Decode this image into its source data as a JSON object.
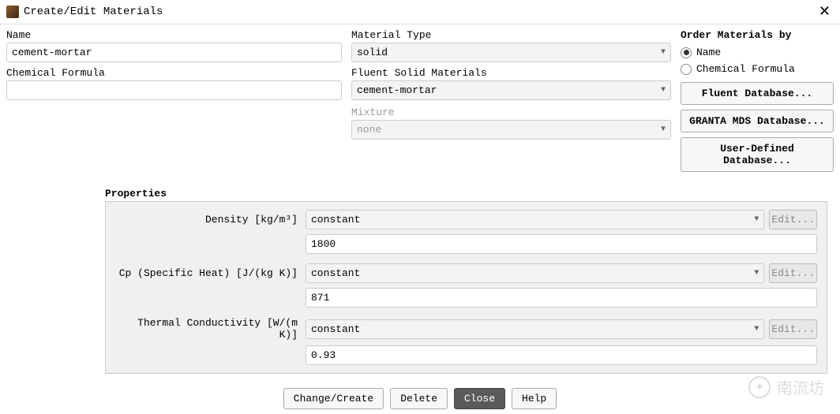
{
  "window": {
    "title": "Create/Edit Materials"
  },
  "left": {
    "name_label": "Name",
    "name_value": "cement-mortar",
    "formula_label": "Chemical Formula",
    "formula_value": ""
  },
  "mid": {
    "type_label": "Material Type",
    "type_value": "solid",
    "fluent_label": "Fluent Solid Materials",
    "fluent_value": "cement-mortar",
    "mixture_label": "Mixture",
    "mixture_value": "none"
  },
  "right": {
    "order_label": "Order Materials by",
    "radio_name": "Name",
    "radio_formula": "Chemical Formula",
    "btn_fluent": "Fluent Database...",
    "btn_granta": "GRANTA MDS Database...",
    "btn_user": "User-Defined Database..."
  },
  "properties": {
    "title": "Properties",
    "density": {
      "label": "Density [kg/m³]",
      "mode": "constant",
      "value": "1800",
      "edit": "Edit..."
    },
    "cp": {
      "label": "Cp (Specific Heat) [J/(kg K)]",
      "mode": "constant",
      "value": "871",
      "edit": "Edit..."
    },
    "k": {
      "label": "Thermal Conductivity [W/(m K)]",
      "mode": "constant",
      "value": "0.93",
      "edit": "Edit..."
    }
  },
  "buttons": {
    "change": "Change/Create",
    "delete": "Delete",
    "close": "Close",
    "help": "Help"
  },
  "watermark": {
    "text": "南流坊"
  }
}
